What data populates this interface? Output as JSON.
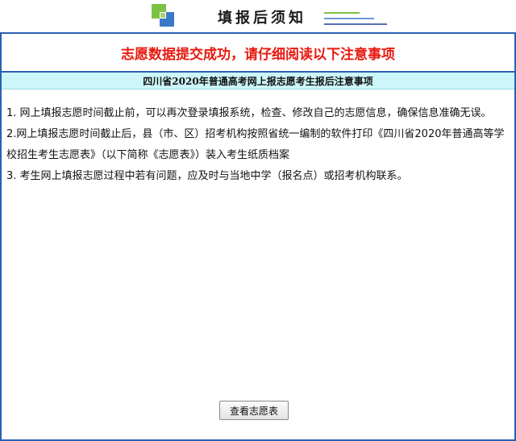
{
  "header": {
    "logo": "green-blue-squares-logo",
    "title": "填报后须知"
  },
  "headline": "志愿数据提交成功，请仔细阅读以下注意事项",
  "notice_title": "四川省2020年普通高考网上报志愿考生报后注意事项",
  "items": [
    "1. 网上填报志愿时间截止前，可以再次登录填报系统，检查、修改自己的志愿信息，确保信息准确无误。",
    "2.网上填报志愿时间截止后，县（市、区）招考机构按照省统一编制的软件打印《四川省2020年普通高等学校招生考生志愿表》（以下简称《志愿表》）装入考生纸质档案",
    "3. 考生网上填报志愿过程中若有问题，应及时与当地中学（报名点）或招考机构联系。"
  ],
  "button": {
    "view_label": "查看志愿表"
  },
  "colors": {
    "frame_border": "#2b5fb4",
    "headline_red": "#e8190f",
    "notice_band": "#ccf6fa",
    "logo_green": "#7cc243",
    "logo_blue": "#3c78c8"
  }
}
